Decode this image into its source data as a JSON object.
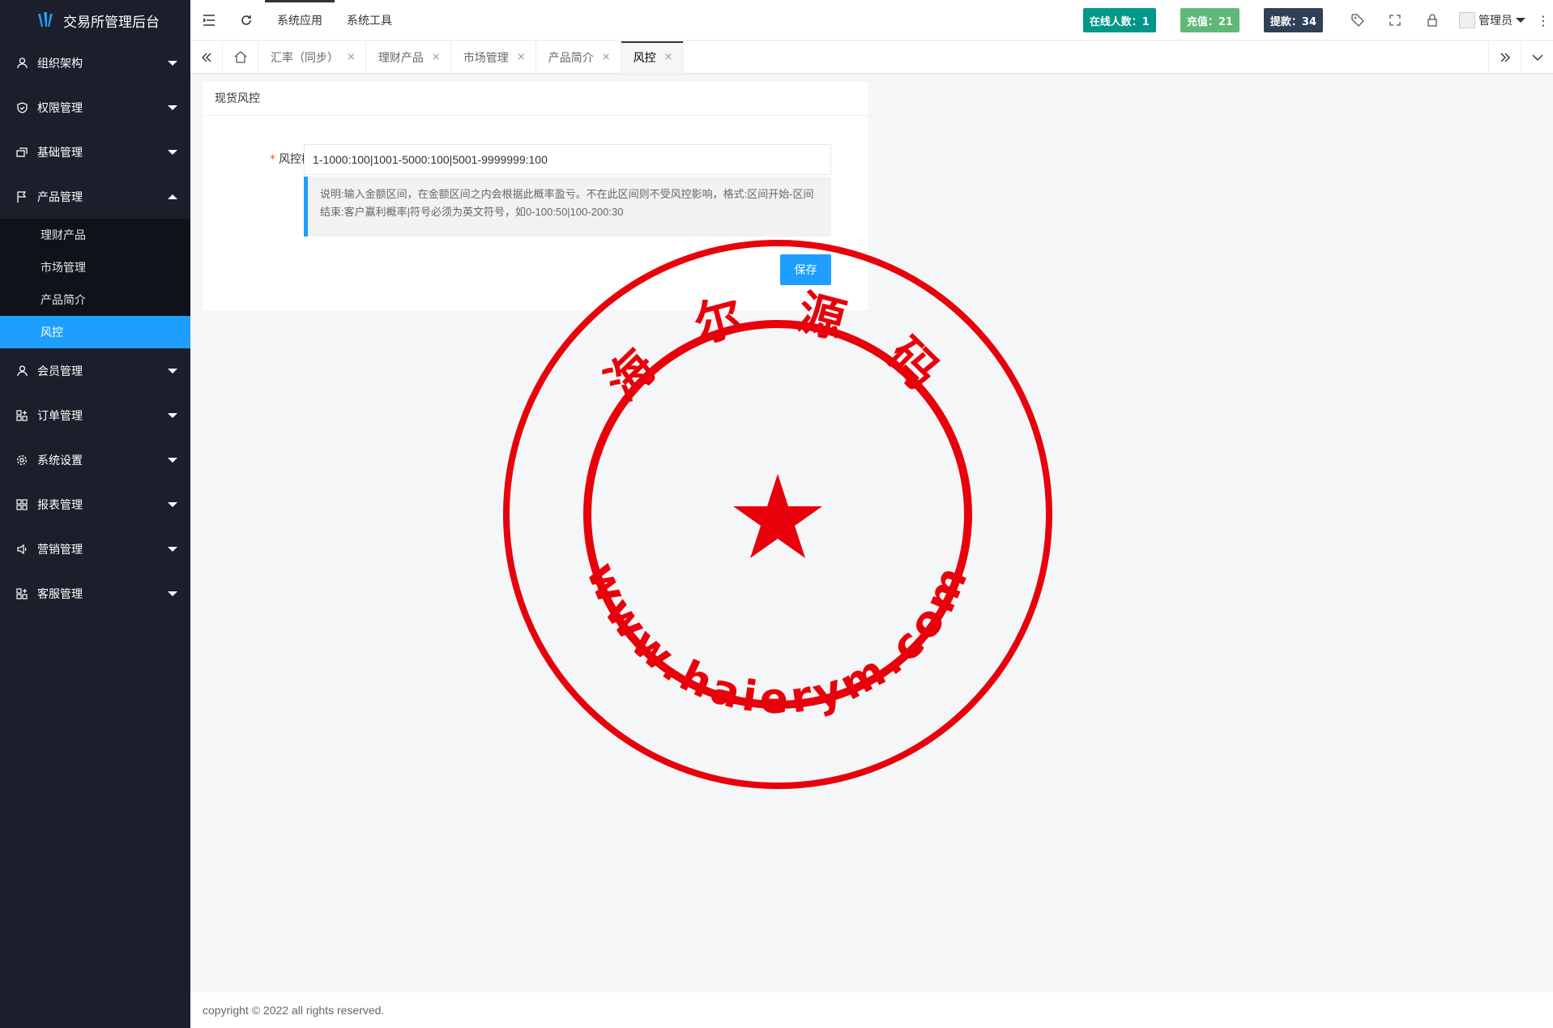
{
  "app": {
    "title": "交易所管理后台"
  },
  "sidebar": {
    "groups": [
      {
        "label": "组织架构",
        "icon": "user-icon"
      },
      {
        "label": "权限管理",
        "icon": "shield-icon"
      },
      {
        "label": "基础管理",
        "icon": "stack-icon"
      },
      {
        "label": "产品管理",
        "icon": "flag-icon",
        "expanded": true,
        "items": [
          {
            "label": "理财产品"
          },
          {
            "label": "市场管理"
          },
          {
            "label": "产品简介"
          },
          {
            "label": "风控",
            "active": true
          }
        ]
      },
      {
        "label": "会员管理",
        "icon": "user-icon"
      },
      {
        "label": "订单管理",
        "icon": "apps-icon"
      },
      {
        "label": "系统设置",
        "icon": "gear-icon"
      },
      {
        "label": "报表管理",
        "icon": "grid-icon"
      },
      {
        "label": "营销管理",
        "icon": "speaker-icon"
      },
      {
        "label": "客服管理",
        "icon": "apps-icon"
      }
    ]
  },
  "header": {
    "nav": [
      "系统应用",
      "系统工具"
    ],
    "badges": [
      {
        "label": "在线人数：1",
        "color": "#009688"
      },
      {
        "label": "充值：21",
        "color": "#5fb878"
      },
      {
        "label": "提款：34",
        "color": "#2f4056"
      }
    ],
    "user": "管理员",
    "more": "⋮"
  },
  "tabs": [
    {
      "label": "汇率（同步）"
    },
    {
      "label": "理财产品"
    },
    {
      "label": "市场管理"
    },
    {
      "label": "产品简介"
    },
    {
      "label": "风控",
      "active": true
    }
  ],
  "tab_close_glyph": "×",
  "card": {
    "title": "现货风控",
    "field_label": "风控概率",
    "field_required_mark": "*",
    "field_value": "1-1000:100|1001-5000:100|5001-9999999:100",
    "note": "说明:输入金额区间，在金额区间之内会根据此概率盈亏。不在此区间则不受风控影响，格式:区间开始-区间结束:客户赢利概率|符号必须为英文符号，如0-100:50|100-200:30",
    "save_label": "保存"
  },
  "footer": {
    "copyright": "copyright © 2022 all rights reserved."
  },
  "watermark": {
    "top_text": "海 尔 源 码",
    "bottom_text": "www.haierym.com",
    "color": "#e8000b"
  }
}
